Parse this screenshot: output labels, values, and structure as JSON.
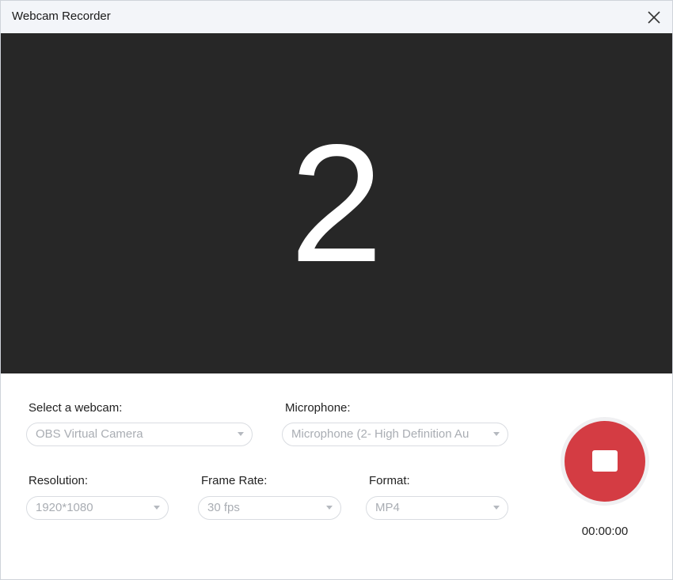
{
  "window": {
    "title": "Webcam Recorder"
  },
  "preview": {
    "countdown": "2",
    "background": "#272727"
  },
  "settings": {
    "webcam": {
      "label": "Select a webcam:",
      "value": "OBS Virtual Camera"
    },
    "microphone": {
      "label": "Microphone:",
      "value": "Microphone (2- High Definition Au"
    },
    "resolution": {
      "label": "Resolution:",
      "value": "1920*1080"
    },
    "frame_rate": {
      "label": "Frame Rate:",
      "value": "30 fps"
    },
    "format": {
      "label": "Format:",
      "value": "MP4"
    }
  },
  "recorder": {
    "timer": "00:00:00",
    "accent": "#d43c43",
    "icon": "stop-icon"
  }
}
